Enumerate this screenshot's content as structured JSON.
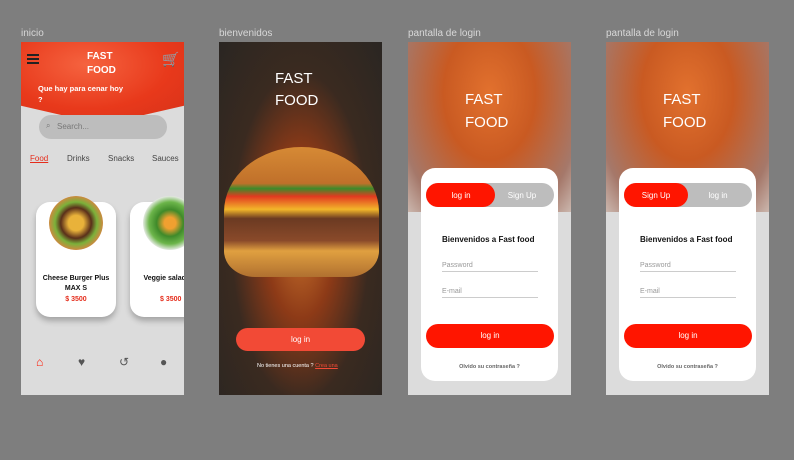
{
  "frames": {
    "inicio": {
      "label": "inicio",
      "title_line1": "FAST",
      "title_line2": "FOOD",
      "greeting": "Que hay para cenar hoy ?",
      "search_placeholder": "Search...",
      "categories": [
        "Food",
        "Drinks",
        "Snacks",
        "Sauces"
      ],
      "active_category": "Food",
      "products": [
        {
          "name": "Cheese Burger Plus MAX S",
          "price": "$ 3500"
        },
        {
          "name": "Veggie salad PLUS",
          "price": "$ 3500"
        }
      ],
      "nav": [
        "home-icon",
        "heart-icon",
        "history-icon",
        "user-icon"
      ]
    },
    "bienvenidos": {
      "label": "bienvenidos",
      "title_line1": "FAST",
      "title_line2": "FOOD",
      "login": "log in",
      "no_account": "No tienes una cuenta ?",
      "create": "Crea una"
    },
    "login1": {
      "label": "pantalla de login",
      "title_line1": "FAST",
      "title_line2": "FOOD",
      "tab_login": "log in",
      "tab_signup": "Sign Up",
      "welcome": "Bienvenidos a Fast food",
      "password": "Password",
      "email": "E-mail",
      "button": "log in",
      "forgot": "Olvido su contraseña ?"
    },
    "login2": {
      "label": "pantalla de login",
      "title_line1": "FAST",
      "title_line2": "FOOD",
      "tab_signup": "Sign Up",
      "tab_login": "log in",
      "welcome": "Bienvenidos a Fast food",
      "password": "Password",
      "email": "E-mail",
      "button": "log in",
      "forgot": "Olvido su contraseña ?"
    }
  },
  "colors": {
    "accent": "#ff1500",
    "brand": "#e8391b",
    "canvas": "#7e7e7e"
  }
}
